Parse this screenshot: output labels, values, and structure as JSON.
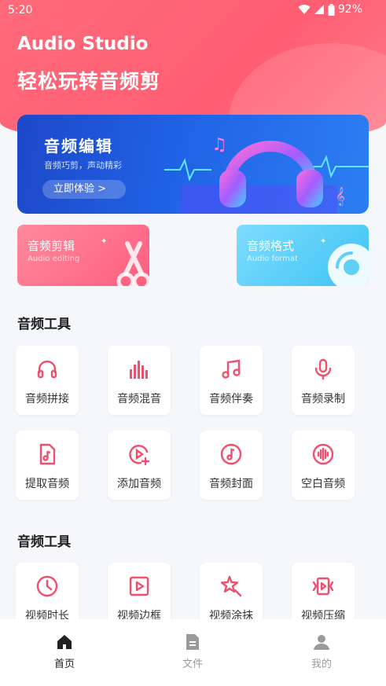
{
  "status_bar": {
    "time": "5:20",
    "battery": "92%"
  },
  "header": {
    "title": "Audio Studio",
    "subtitle": "轻松玩转音频剪"
  },
  "banner": {
    "title": "音频编辑",
    "subtitle": "音频巧剪，声动精彩",
    "button_label": "立即体验 >"
  },
  "feature_cards": [
    {
      "title": "音频剪辑",
      "subtitle": "Audio editing",
      "icon": "scissors-icon"
    },
    {
      "title": "音频格式",
      "subtitle": "Audio format",
      "icon": "disc-icon"
    }
  ],
  "sections": [
    {
      "title": "音频工具"
    },
    {
      "title": "音频工具"
    }
  ],
  "tools": [
    {
      "label": "音频拼接",
      "icon": "headphones-icon"
    },
    {
      "label": "音频混音",
      "icon": "equalizer-icon"
    },
    {
      "label": "音频伴奏",
      "icon": "music-note-icon"
    },
    {
      "label": "音频录制",
      "icon": "microphone-icon"
    },
    {
      "label": "提取音频",
      "icon": "music-file-icon"
    },
    {
      "label": "添加音频",
      "icon": "play-add-icon"
    },
    {
      "label": "音频封面",
      "icon": "music-disc-icon"
    },
    {
      "label": "空白音频",
      "icon": "waveform-icon"
    },
    {
      "label": "视频时长",
      "icon": "clock-icon"
    },
    {
      "label": "视频边框",
      "icon": "video-frame-icon"
    },
    {
      "label": "视频涂抹",
      "icon": "magic-star-icon"
    },
    {
      "label": "视频压缩",
      "icon": "video-compress-icon"
    }
  ],
  "bottom_nav": [
    {
      "label": "首页",
      "icon": "home-icon",
      "active": true
    },
    {
      "label": "文件",
      "icon": "file-icon",
      "active": false
    },
    {
      "label": "我的",
      "icon": "user-icon",
      "active": false
    }
  ],
  "colors": {
    "accent": "#ff5e73",
    "icon_red": "#f0506e",
    "nav_active": "#222222",
    "nav_inactive": "#9a9a9a"
  }
}
